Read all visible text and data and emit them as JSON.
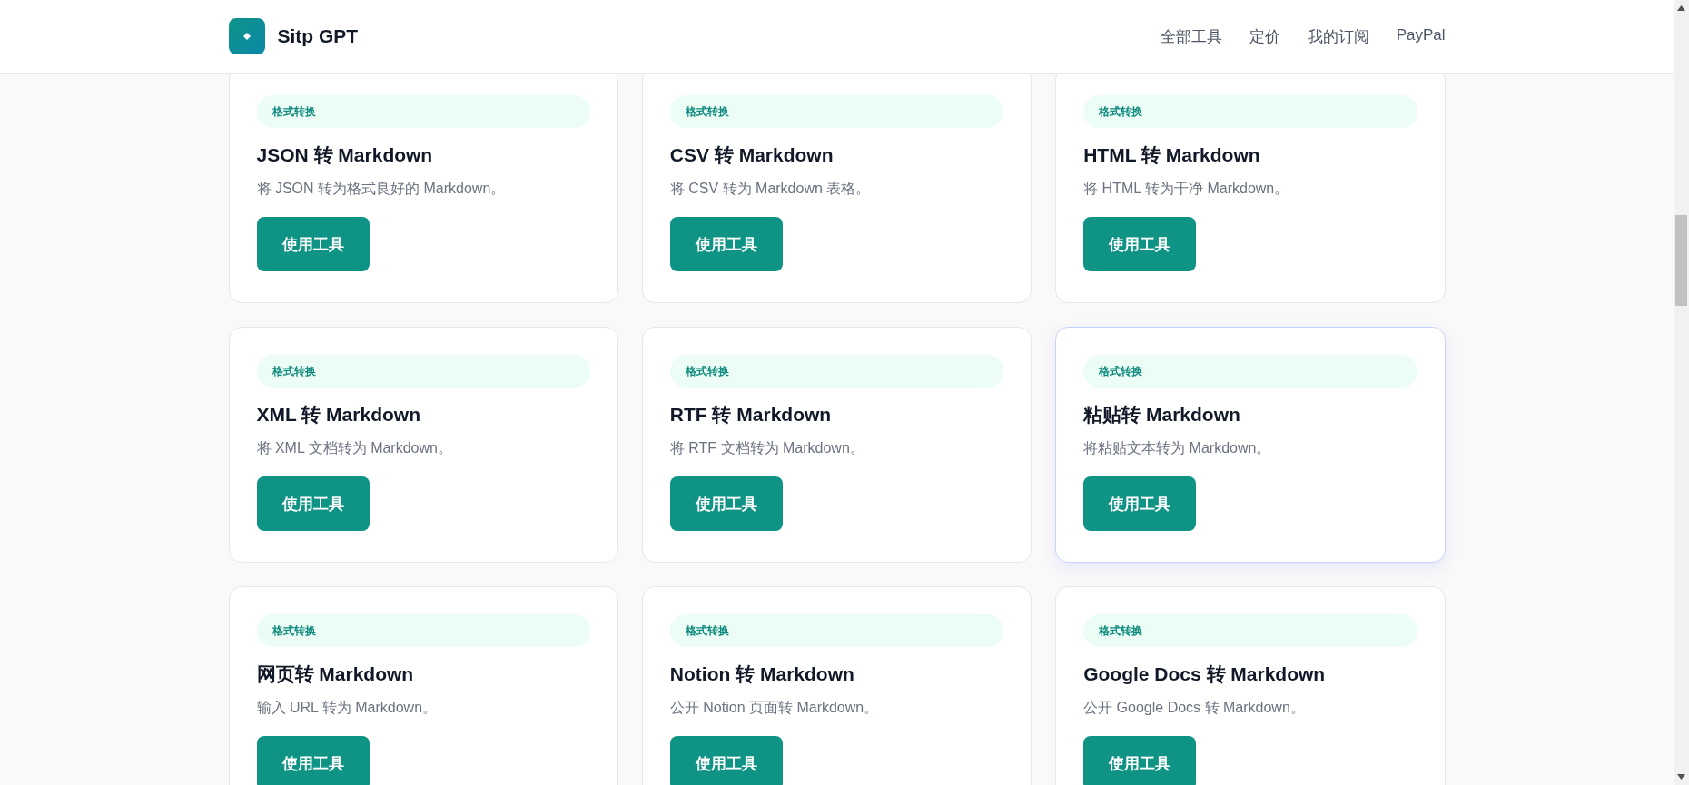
{
  "header": {
    "brand": "Sitp GPT",
    "nav": [
      "全部工具",
      "定价",
      "我的订阅",
      "PayPal"
    ]
  },
  "cards": [
    {
      "tag": "格式转换",
      "title": "JSON 转 Markdown",
      "description": "将 JSON 转为格式良好的 Markdown。",
      "button": "使用工具",
      "highlighted": false
    },
    {
      "tag": "格式转换",
      "title": "CSV 转 Markdown",
      "description": "将 CSV 转为 Markdown 表格。",
      "button": "使用工具",
      "highlighted": false
    },
    {
      "tag": "格式转换",
      "title": "HTML 转 Markdown",
      "description": "将 HTML 转为干净 Markdown。",
      "button": "使用工具",
      "highlighted": false
    },
    {
      "tag": "格式转换",
      "title": "XML 转 Markdown",
      "description": "将 XML 文档转为 Markdown。",
      "button": "使用工具",
      "highlighted": false
    },
    {
      "tag": "格式转换",
      "title": "RTF 转 Markdown",
      "description": "将 RTF 文档转为 Markdown。",
      "button": "使用工具",
      "highlighted": false
    },
    {
      "tag": "格式转换",
      "title": "粘贴转 Markdown",
      "description": "将粘贴文本转为 Markdown。",
      "button": "使用工具",
      "highlighted": true
    },
    {
      "tag": "格式转换",
      "title": "网页转 Markdown",
      "description": "输入 URL 转为 Markdown。",
      "button": "使用工具",
      "highlighted": false
    },
    {
      "tag": "格式转换",
      "title": "Notion 转 Markdown",
      "description": "公开 Notion 页面转 Markdown。",
      "button": "使用工具",
      "highlighted": false
    },
    {
      "tag": "格式转换",
      "title": "Google Docs 转 Markdown",
      "description": "公开 Google Docs 转 Markdown。",
      "button": "使用工具",
      "highlighted": false
    }
  ]
}
